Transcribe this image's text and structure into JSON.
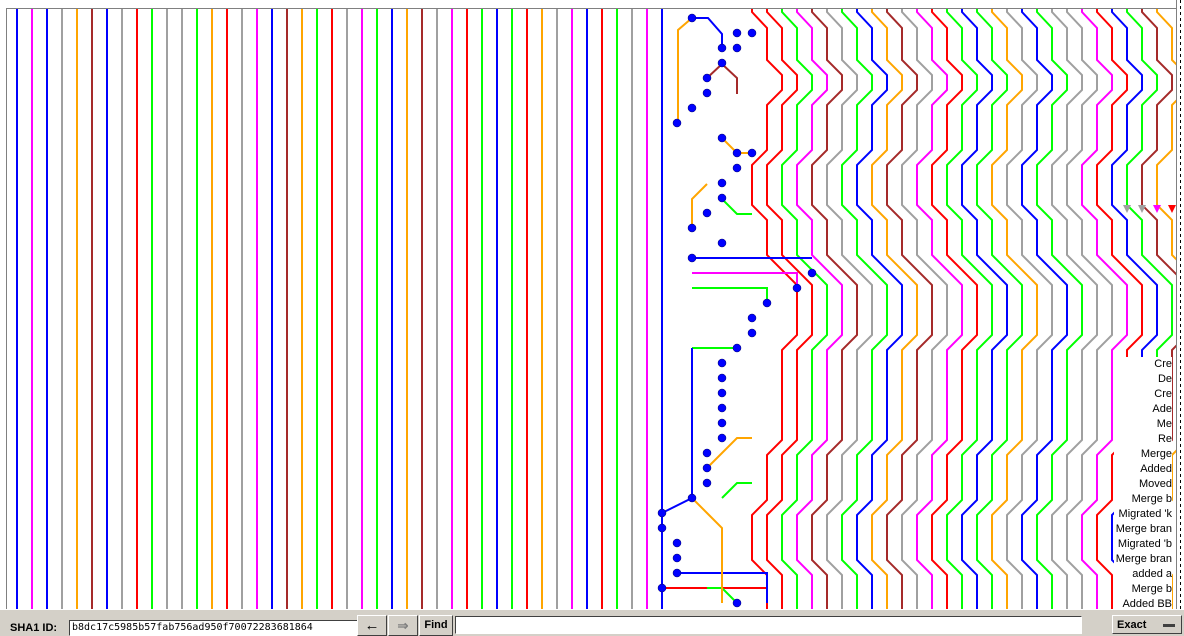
{
  "graph": {
    "colors": [
      "#0000ff",
      "#ff0000",
      "#00ff00",
      "#ff00ff",
      "#a52a2a",
      "#a0a0a0",
      "#ffa500"
    ],
    "node_color": "#0000ff",
    "parallel_lane_count": 44,
    "commit_summaries": [
      "Cre",
      "De",
      "Cre",
      "Ade",
      "Me",
      "Re",
      "Merge",
      "Added",
      "Moved",
      "Merge b",
      "Migrated 'k",
      "Merge bran",
      "Migrated 'b",
      "Merge bran",
      "added a",
      "Merge b",
      "Added BB"
    ]
  },
  "search_bar": {
    "sha1_label": "SHA1 ID:",
    "sha1_value": "b8dc17c5985b57fab756ad950f70072283681864",
    "back_icon": "←",
    "forward_icon": "⇒",
    "find_label": "Find",
    "find_value": "",
    "match_mode": "Exact"
  }
}
